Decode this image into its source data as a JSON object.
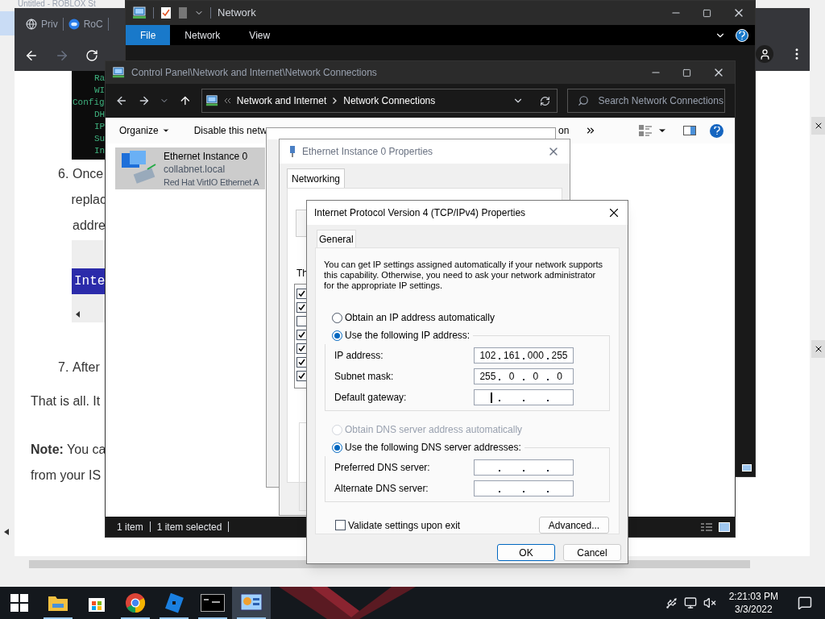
{
  "roblox_window": {
    "title": "Untitled - ROBLOX St"
  },
  "browser": {
    "tabs": [
      {
        "label": "Priv",
        "selected": false
      },
      {
        "label": "RoC",
        "selected": false
      }
    ],
    "code_lines": [
      {
        "text": "Ra",
        "indent": true
      },
      {
        "text": "WI",
        "indent": true
      },
      {
        "text": "Config",
        "indent": false
      },
      {
        "text": "DH",
        "indent": true
      },
      {
        "text": "IP",
        "indent": true
      },
      {
        "text": "Su",
        "indent": true
      },
      {
        "text": "In",
        "indent": true
      }
    ],
    "steps": [
      {
        "number": "6.",
        "lines": [
          "Once",
          "replac",
          "addre"
        ],
        "code": "Inte"
      },
      {
        "number": "7.",
        "lines": [
          "After"
        ]
      }
    ],
    "paragraphs": [
      {
        "lines": [
          "That is all. It"
        ]
      },
      {
        "lines": [
          "**Note:** You ca",
          "from your IS"
        ]
      }
    ]
  },
  "network_window": {
    "title": "Network",
    "ribbon_tabs": [
      {
        "label": "File",
        "selected": true
      },
      {
        "label": "Network",
        "selected": false
      },
      {
        "label": "View",
        "selected": false
      }
    ]
  },
  "connections_window": {
    "title": "Control Panel\\Network and Internet\\Network Connections",
    "breadcrumb": [
      "Network and Internet",
      "Network Connections"
    ],
    "search_placeholder": "Search Network Connections",
    "toolbar": [
      {
        "label": "Organize",
        "kind": "menu"
      },
      {
        "label": "Disable this netw",
        "kind": "action"
      }
    ],
    "toolbar_tail": "on",
    "item": {
      "name": "Ethernet Instance 0",
      "domain": "collabnet.local",
      "adapter": "Red Hat VirtIO Ethernet A",
      "selected": true
    },
    "status": [
      "1 item",
      "1 item selected"
    ]
  },
  "properties_window": {
    "title": "Ethernet Instance 0 Properties",
    "tabs": [
      {
        "label": "Networking",
        "selected": true
      }
    ],
    "list_label": "Th",
    "components": [
      {
        "checked": true
      },
      {
        "checked": true
      },
      {
        "checked": false
      },
      {
        "checked": true
      },
      {
        "checked": true
      },
      {
        "checked": true
      },
      {
        "checked": true
      }
    ]
  },
  "ipv4_dialog": {
    "title": "Internet Protocol Version 4 (TCP/IPv4) Properties",
    "tabs": [
      {
        "label": "General",
        "selected": true
      }
    ],
    "intro": "You can get IP settings assigned automatically if your network supports this capability. Otherwise, you need to ask your network administrator for the appropriate IP settings.",
    "ip_options": [
      {
        "label": "Obtain an IP address automatically",
        "selected": false,
        "disabled": false
      },
      {
        "label": "Use the following IP address:",
        "selected": true,
        "disabled": false
      }
    ],
    "ip_fields": [
      {
        "label": "IP address:",
        "octets": [
          "102",
          "161",
          "000",
          "255"
        ]
      },
      {
        "label": "Subnet mask:",
        "octets": [
          "255",
          "0",
          "0",
          "0"
        ]
      },
      {
        "label": "Default gateway:",
        "focused": true
      }
    ],
    "dns_options": [
      {
        "label": "Obtain DNS server address automatically",
        "selected": false,
        "disabled": true
      },
      {
        "label": "Use the following DNS server addresses:",
        "selected": true,
        "disabled": false
      }
    ],
    "dns_fields": [
      {
        "label": "Preferred DNS server:"
      },
      {
        "label": "Alternate DNS server:"
      }
    ],
    "validate": {
      "label": "Validate settings upon exit",
      "checked": false
    },
    "advanced": "Advanced...",
    "ok": "OK",
    "cancel": "Cancel"
  },
  "taskbar": {
    "apps": [
      {
        "kind": "explorer",
        "running": true,
        "active": false
      },
      {
        "kind": "store",
        "running": false,
        "active": false
      },
      {
        "kind": "chrome",
        "running": true,
        "active": false
      },
      {
        "kind": "roblox",
        "running": true,
        "active": false
      },
      {
        "kind": "terminal",
        "running": true,
        "active": false
      },
      {
        "kind": "control-panel",
        "running": true,
        "active": true
      }
    ],
    "time": "2:21:03 PM",
    "date": "3/3/2022"
  }
}
